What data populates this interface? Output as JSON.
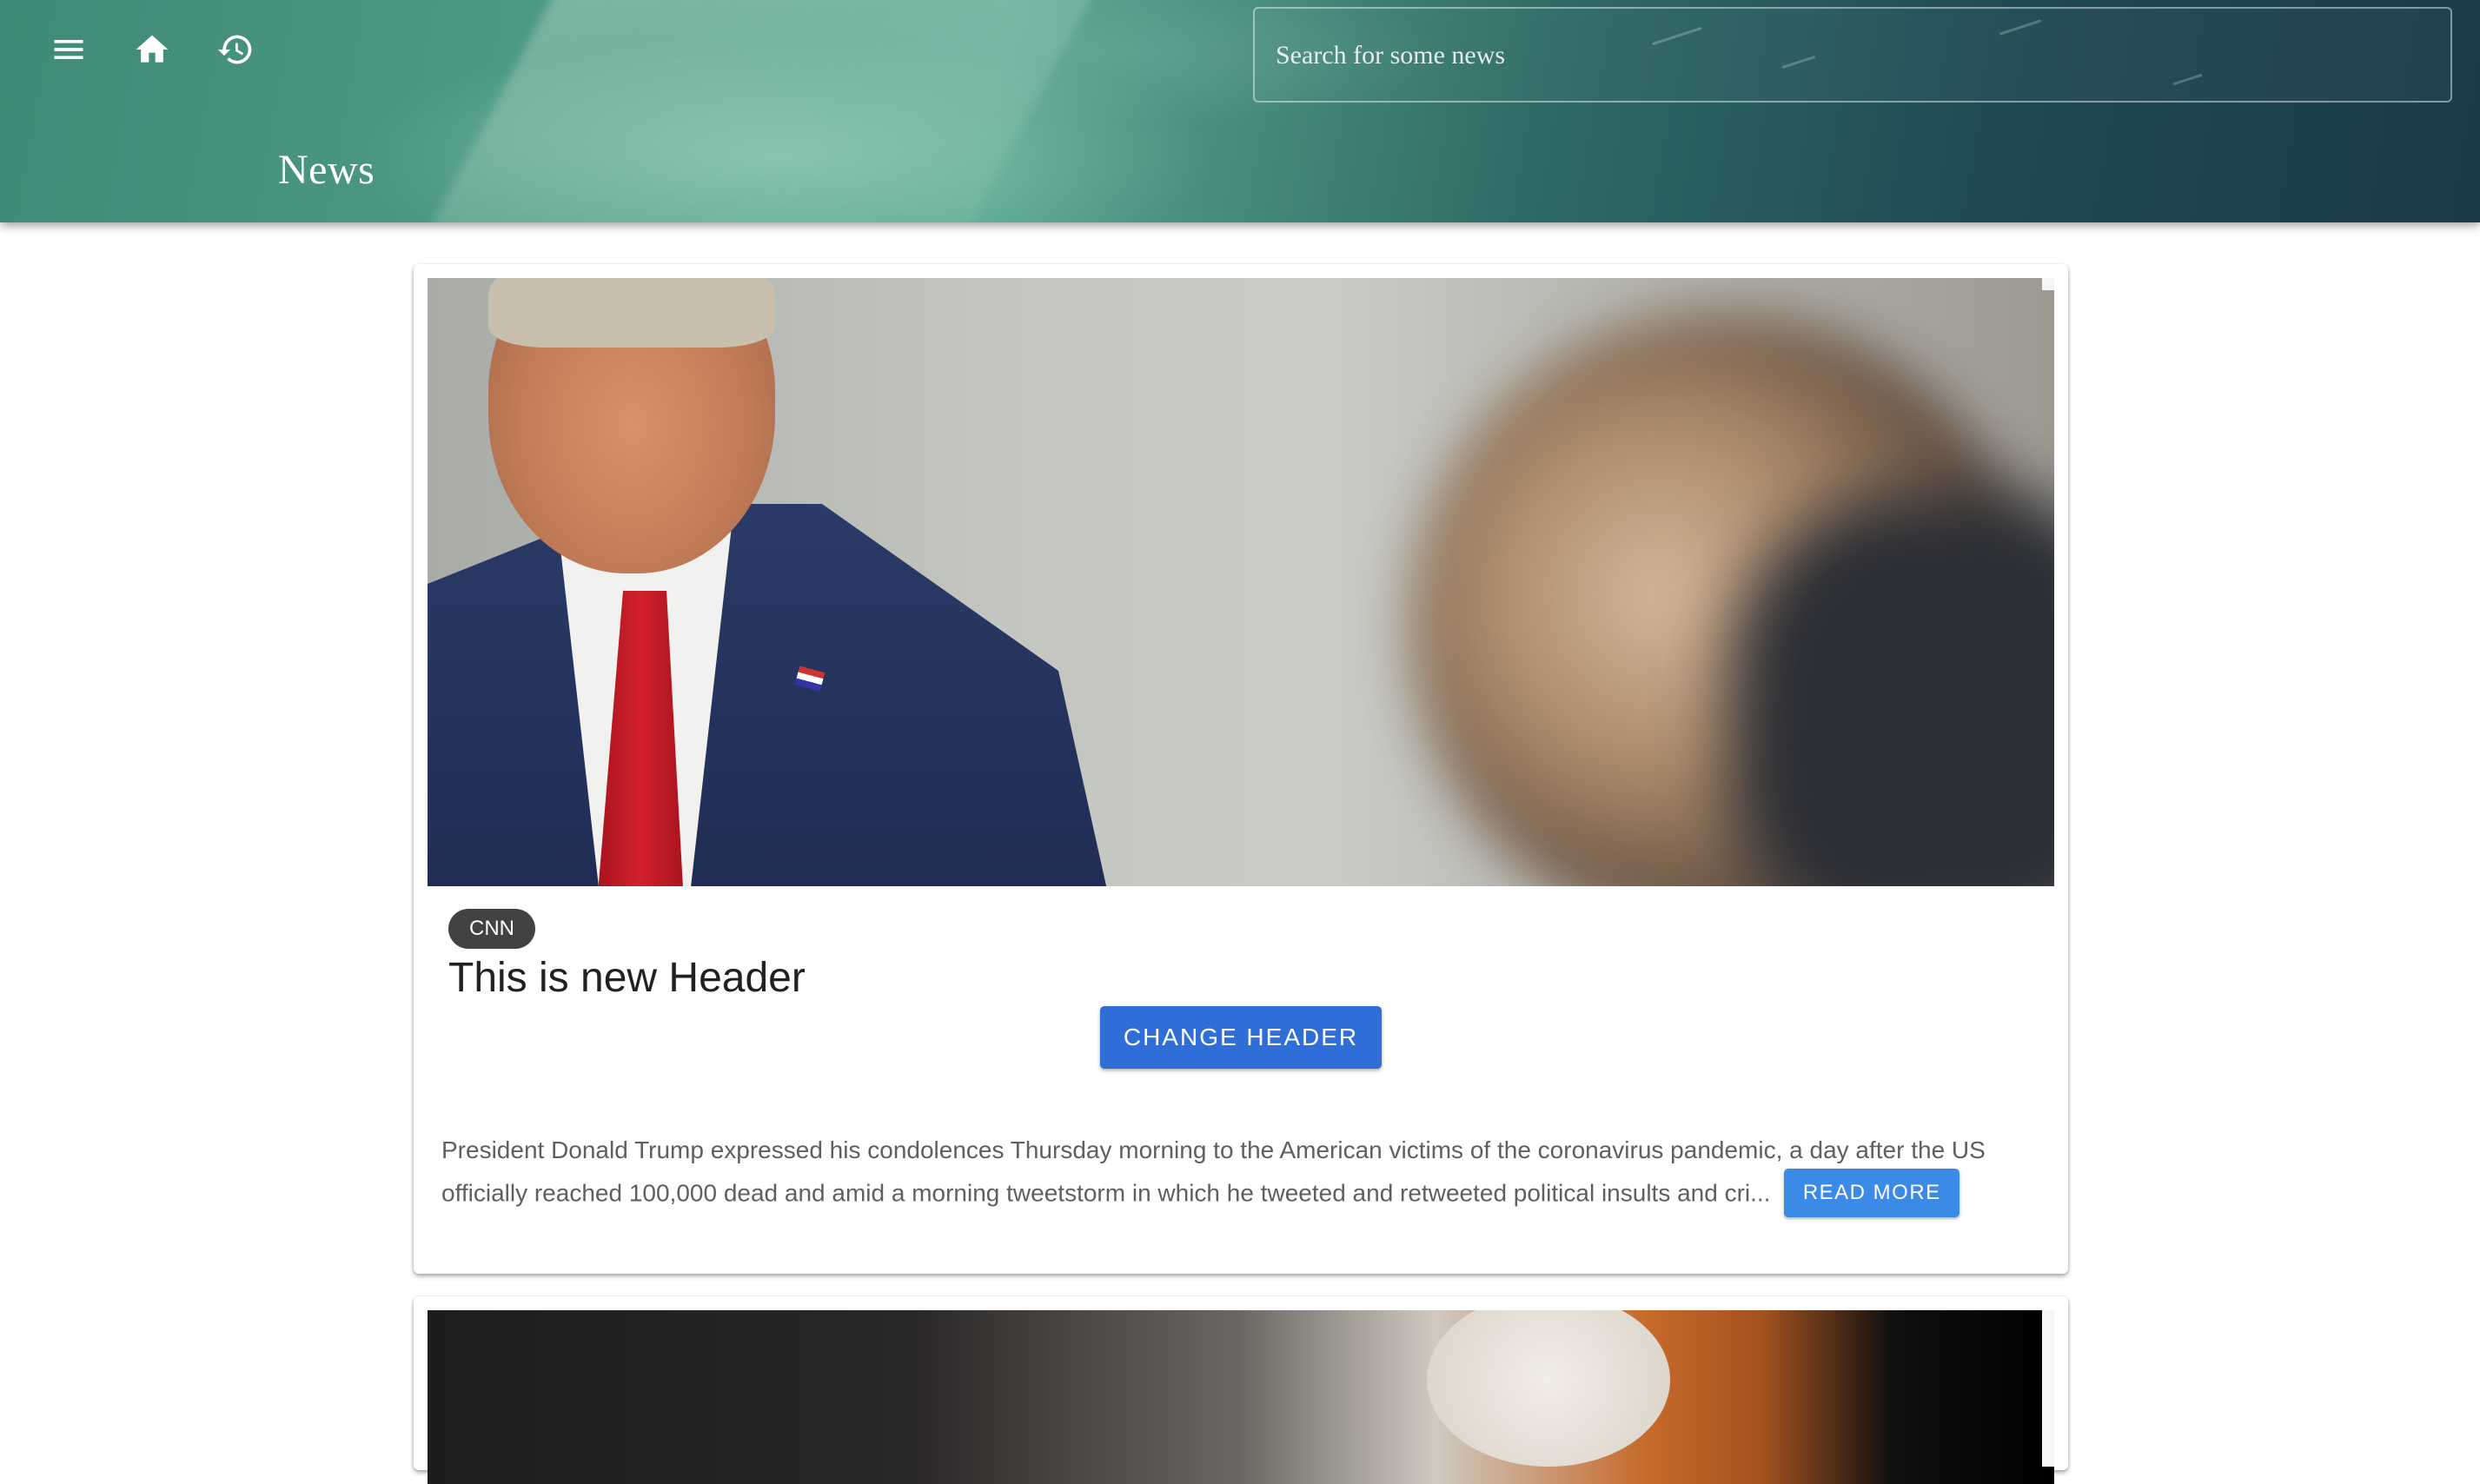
{
  "header": {
    "title": "News",
    "search": {
      "placeholder": "Search for some news",
      "value": ""
    },
    "icons": [
      "menu-icon",
      "home-icon",
      "history-icon"
    ]
  },
  "articles": [
    {
      "source": "CNN",
      "title": "This is new Header",
      "change_header_label": "CHANGE HEADER",
      "description": "President Donald Trump expressed his condolences Thursday morning to the American victims of the coronavirus pandemic, a day after the US officially reached 100,000 dead and amid a morning tweetstorm in which he tweeted and retweeted political insults and cri...",
      "read_more_label": "READ MORE"
    },
    {
      "source": "",
      "title": ""
    }
  ],
  "colors": {
    "primary_button": "#2e6ed6",
    "read_more_button": "#3b8ae6",
    "chip_background": "#424242"
  }
}
